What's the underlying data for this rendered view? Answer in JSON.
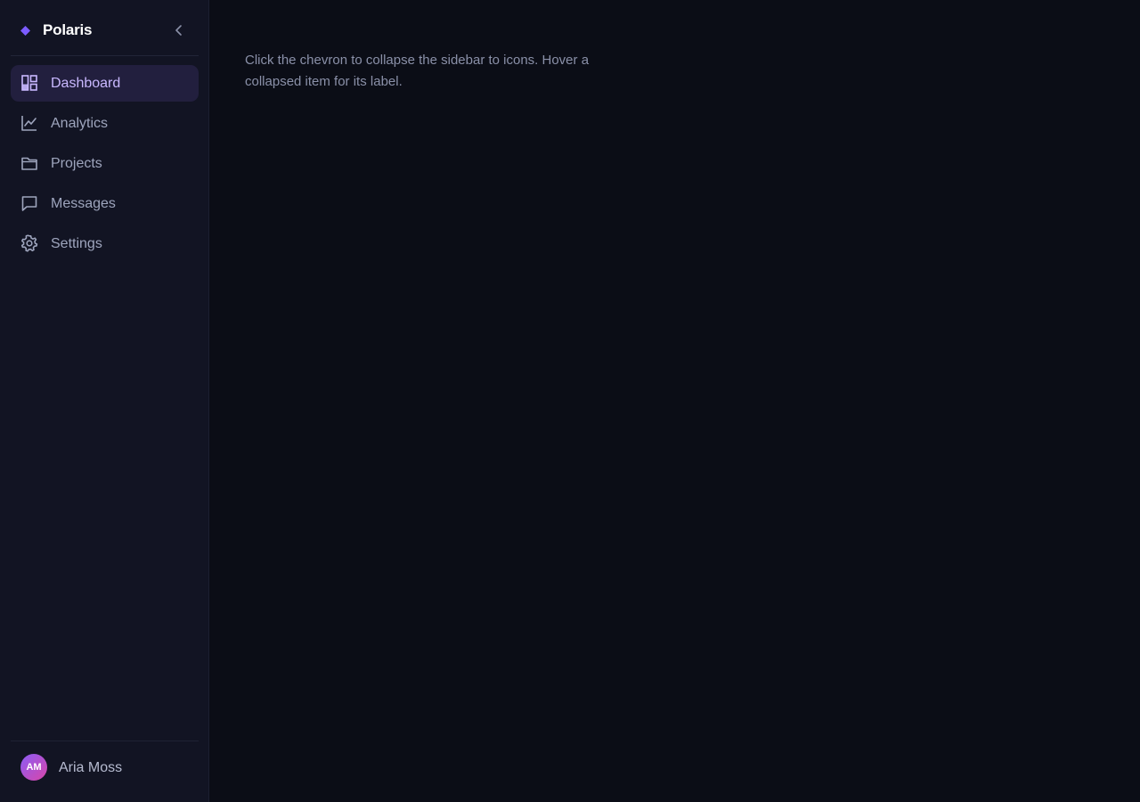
{
  "brand": {
    "name": "Polaris",
    "accent_color": "#7c5cff",
    "collapse_icon": "chevron-left-icon"
  },
  "sidebar": {
    "items": [
      {
        "label": "Dashboard",
        "icon": "layout-dashboard-icon",
        "active": true
      },
      {
        "label": "Analytics",
        "icon": "line-chart-icon",
        "active": false
      },
      {
        "label": "Projects",
        "icon": "folder-icon",
        "active": false
      },
      {
        "label": "Messages",
        "icon": "message-square-icon",
        "active": false
      },
      {
        "label": "Settings",
        "icon": "gear-icon",
        "active": false
      }
    ]
  },
  "user": {
    "initials": "AM",
    "name": "Aria Moss"
  },
  "main": {
    "hint": "Click the chevron to collapse the sidebar to icons. Hover a collapsed item for its label."
  },
  "colors": {
    "sidebar_bg": "#121423",
    "main_bg": "#0b0d16",
    "active_item_bg": "#221f3e",
    "active_text": "#c9b8ff",
    "text_muted": "#9ea5bd"
  }
}
